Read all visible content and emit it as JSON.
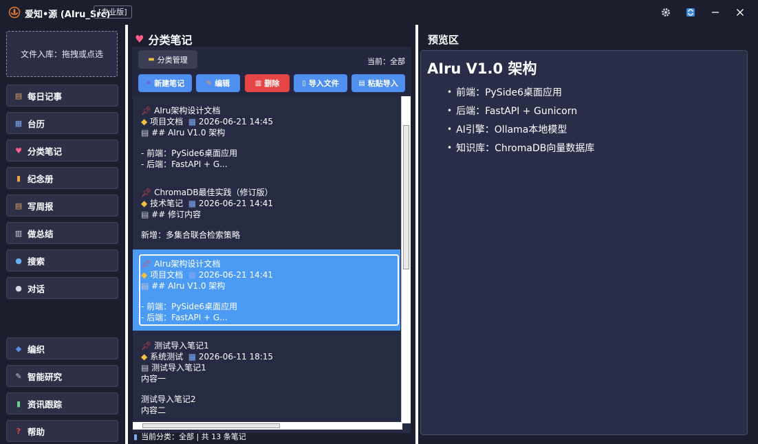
{
  "window": {
    "app_title": "爱知•源 (AIru_Src)",
    "edition": "[专业版]",
    "controls": [
      "gear-icon",
      "sync-icon",
      "minimize-icon",
      "close-icon"
    ]
  },
  "sidebar": {
    "dropzone": "文件入库：拖拽或点选",
    "items": [
      {
        "label": "每日记事",
        "icon": "notepad-icon"
      },
      {
        "label": "台历",
        "icon": "calendar-icon"
      },
      {
        "label": "分类笔记",
        "icon": "heart-icon"
      },
      {
        "label": "纪念册",
        "icon": "album-icon"
      },
      {
        "label": "写周报",
        "icon": "report-icon"
      },
      {
        "label": "做总结",
        "icon": "summary-icon"
      },
      {
        "label": "搜索",
        "icon": "search-icon"
      },
      {
        "label": "对话",
        "icon": "chat-icon"
      },
      {
        "label": "编织",
        "icon": "weave-icon"
      },
      {
        "label": "智能研究",
        "icon": "research-icon"
      },
      {
        "label": "资讯跟踪",
        "icon": "chart-icon"
      },
      {
        "label": "帮助",
        "icon": "help-icon"
      }
    ]
  },
  "notes_panel": {
    "title": "分类笔记",
    "category_button": "分类管理",
    "current": "当前：全部",
    "actions": {
      "new": "新建笔记",
      "edit": "编辑",
      "delete": "删除",
      "import": "导入文件",
      "paste": "粘贴导入"
    },
    "notes": [
      {
        "title": "AIru架构设计文档",
        "category": "项目文档",
        "date": "2026-06-21 14:45",
        "heading": "## AIru V1.0 架构",
        "lines": [
          "- 前端：PySide6桌面应用",
          "- 后端：FastAPI + G..."
        ],
        "selected": false
      },
      {
        "title": "ChromaDB最佳实践（修订版）",
        "category": "技术笔记",
        "date": "2026-06-21 14:41",
        "heading": "## 修订内容",
        "lines": [
          "新增：多集合联合检索策略"
        ],
        "selected": false
      },
      {
        "title": "AIru架构设计文档",
        "category": "项目文档",
        "date": "2026-06-21 14:41",
        "heading": "## AIru V1.0 架构",
        "lines": [
          "- 前端：PySide6桌面应用",
          "- 后端：FastAPI + G..."
        ],
        "selected": true
      },
      {
        "title": "测试导入笔记1",
        "category": "系统测试",
        "date": "2026-06-11 18:15",
        "heading": "测试导入笔记1",
        "body": [
          "内容一",
          "测试导入笔记2",
          "内容二"
        ],
        "selected": false
      }
    ],
    "status": "当前分类：全部 | 共 13 条笔记"
  },
  "preview": {
    "title": "预览区",
    "heading": "AIru V1.0 架构",
    "items": [
      "前端：PySide6桌面应用",
      "后端：FastAPI + Gunicorn",
      "AI引擎：Ollama本地模型",
      "知识库：ChromaDB向量数据库"
    ]
  },
  "colors": {
    "background": "#1b1e2d",
    "button_blue": "#4e8ff0",
    "button_red": "#e74545",
    "selected": "#4b9bf5",
    "panel": "#2a2d48"
  }
}
